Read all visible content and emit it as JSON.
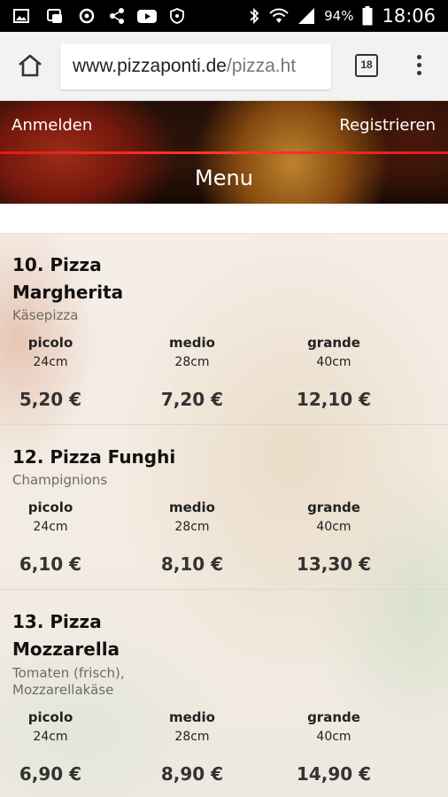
{
  "status_bar": {
    "icons": [
      "image-icon",
      "games-icon",
      "sync-icon",
      "share-icon",
      "youtube-icon",
      "shield-icon"
    ],
    "bluetooth": "bluetooth-icon",
    "wifi": "wifi-icon",
    "signal": "signal-icon",
    "battery_text": "94%",
    "time": "18:06"
  },
  "browser": {
    "url_host": "www.pizzaponti.de",
    "url_path": "/pizza.ht",
    "tab_count": "18"
  },
  "header": {
    "login": "Anmelden",
    "register": "Registrieren",
    "title": "Menu"
  },
  "menu_items": [
    {
      "name_line1": "10. Pizza",
      "name_line2": "Margherita",
      "desc_line1": "Käsepizza",
      "desc_line2": "",
      "sizes": [
        {
          "label": "picolo",
          "cm": "24cm",
          "price": "5,20 €"
        },
        {
          "label": "medio",
          "cm": "28cm",
          "price": "7,20 €"
        },
        {
          "label": "grande",
          "cm": "40cm",
          "price": "12,10 €"
        }
      ]
    },
    {
      "name_line1": "12. Pizza Funghi",
      "name_line2": "",
      "desc_line1": "Champignions",
      "desc_line2": "",
      "sizes": [
        {
          "label": "picolo",
          "cm": "24cm",
          "price": "6,10 €"
        },
        {
          "label": "medio",
          "cm": "28cm",
          "price": "8,10 €"
        },
        {
          "label": "grande",
          "cm": "40cm",
          "price": "13,30 €"
        }
      ]
    },
    {
      "name_line1": "13. Pizza",
      "name_line2": "Mozzarella",
      "desc_line1": "Tomaten (frisch),",
      "desc_line2": "Mozzarellakäse",
      "sizes": [
        {
          "label": "picolo",
          "cm": "24cm",
          "price": "6,90 €"
        },
        {
          "label": "medio",
          "cm": "28cm",
          "price": "8,90 €"
        },
        {
          "label": "grande",
          "cm": "40cm",
          "price": "14,90 €"
        }
      ]
    }
  ]
}
